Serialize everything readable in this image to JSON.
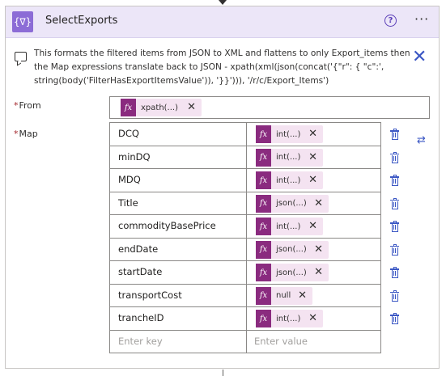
{
  "card": {
    "title": "SelectExports",
    "header_icon": "{∇}",
    "comment": "This formats the filtered items from JSON to XML and flattens to only Export_items then the Map expressions translate back to JSON - xpath(xml(json(concat('{\"r\": { \"c\":', string(body('FilterHasExportItemsValue')), '}}'))), '/r/c/Export_Items')"
  },
  "from": {
    "required_mark": "*",
    "label": "From",
    "token": {
      "fx": "fx",
      "label": "xpath(...)",
      "close": "✕"
    }
  },
  "map": {
    "required_mark": "*",
    "label": "Map",
    "rows": [
      {
        "key": "DCQ",
        "value": "int(...)"
      },
      {
        "key": "minDQ",
        "value": "int(...)"
      },
      {
        "key": "MDQ",
        "value": "int(...)"
      },
      {
        "key": "Title",
        "value": "json(...)"
      },
      {
        "key": "commodityBasePrice",
        "value": "int(...)"
      },
      {
        "key": "endDate",
        "value": "json(...)"
      },
      {
        "key": "startDate",
        "value": "json(...)"
      },
      {
        "key": "transportCost",
        "value": "null"
      },
      {
        "key": "trancheID",
        "value": "int(...)"
      }
    ],
    "key_placeholder": "Enter key",
    "value_placeholder": "Enter value",
    "fx": "fx",
    "close": "✕"
  },
  "icons": {
    "help": "?",
    "more": "···",
    "close": "✕",
    "switch": "⇄"
  },
  "colors": {
    "header_bg": "#ece6f8",
    "header_icon": "#8c6cd6",
    "token_fx": "#8a2b7f",
    "token_bg": "#f4e3f1",
    "accent": "#3b57c4",
    "required": "#a4262c"
  }
}
